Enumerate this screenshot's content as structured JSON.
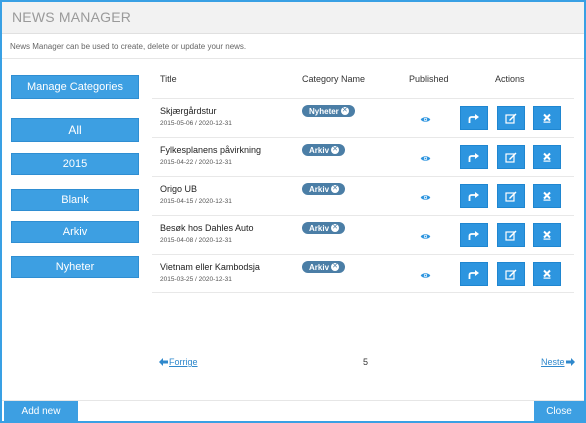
{
  "header": {
    "title": "NEWS MANAGER",
    "subtitle": "News Manager can be used to create, delete or update your news."
  },
  "sidebar": {
    "manage_label": "Manage Categories",
    "items": [
      {
        "label": "All"
      },
      {
        "label": "2015"
      },
      {
        "label": "Blank"
      },
      {
        "label": "Arkiv"
      },
      {
        "label": "Nyheter"
      }
    ]
  },
  "table": {
    "columns": [
      "Title",
      "Category Name",
      "Published",
      "Actions"
    ],
    "rows": [
      {
        "title": "Skjærgårdstur",
        "dates": "2015-05-06 / 2020-12-31",
        "category": "Nyheter"
      },
      {
        "title": "Fylkesplanens påvirkning",
        "dates": "2015-04-22 / 2020-12-31",
        "category": "Arkiv"
      },
      {
        "title": "Origo UB",
        "dates": "2015-04-15 / 2020-12-31",
        "category": "Arkiv"
      },
      {
        "title": "Besøk hos Dahles Auto",
        "dates": "2015-04-08 / 2020-12-31",
        "category": "Arkiv"
      },
      {
        "title": "Vietnam eller Kambodsja",
        "dates": "2015-03-25 / 2020-12-31",
        "category": "Arkiv"
      }
    ]
  },
  "pagination": {
    "prev_label": "Forrige",
    "page": "5",
    "next_label": "Neste"
  },
  "footer": {
    "add_new_label": "Add new",
    "close_label": "Close"
  },
  "colors": {
    "accent": "#3d9fe2",
    "badge": "#4b7ea6",
    "border": "#39a0e4"
  },
  "icons": {
    "published": "eye-icon",
    "share": "share-icon",
    "edit": "edit-icon",
    "delete": "delete-icon",
    "badge_remove": "remove-circle-icon"
  }
}
